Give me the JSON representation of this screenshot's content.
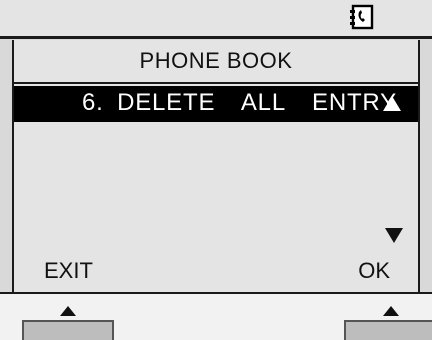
{
  "status_bar": {
    "icon": "phonebook-icon"
  },
  "screen": {
    "title": "PHONE BOOK",
    "selected_item": {
      "label": "6. DELETE  ALL  ENTRY",
      "icon_up": "up-arrow-icon"
    },
    "scroll_down_icon": "down-arrow-icon",
    "softkeys": {
      "left_label": "EXIT",
      "right_label": "OK"
    }
  },
  "colors": {
    "background": "#e4e4e4",
    "highlight": "#000000",
    "highlight_text": "#ffffff"
  }
}
